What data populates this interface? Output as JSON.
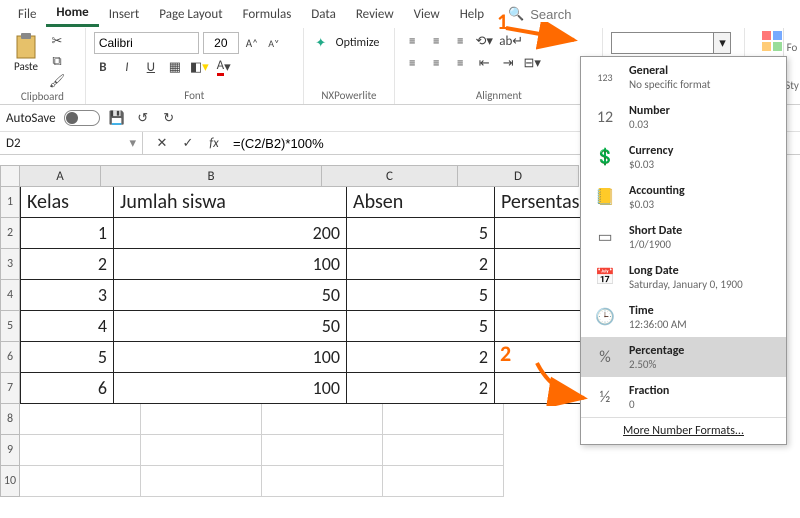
{
  "tabs": {
    "file": "File",
    "home": "Home",
    "insert": "Insert",
    "pagelayout": "Page Layout",
    "formulas": "Formulas",
    "data": "Data",
    "review": "Review",
    "view": "View",
    "help": "Help"
  },
  "search_placeholder": "Search",
  "ribbon": {
    "paste": "Paste",
    "clipboard": "Clipboard",
    "font": "Font",
    "nxp": "NXPowerlite",
    "alignment": "Alignment",
    "styles": "Sty",
    "format": "Fo",
    "font_name": "Calibri",
    "font_size": "20",
    "optimize": "Optimize"
  },
  "autosave": "AutoSave",
  "namebox": "D2",
  "formula": "=(C2/B2)*100%",
  "cols": {
    "A": "A",
    "B": "B",
    "C": "C",
    "D": "D"
  },
  "headers": {
    "A": "Kelas",
    "B": "Jumlah siswa",
    "C": "Absen",
    "D": "Persentase"
  },
  "rows": [
    {
      "n": "1"
    },
    {
      "n": "2",
      "A": "1",
      "B": "200",
      "C": "5",
      "D": ""
    },
    {
      "n": "3",
      "A": "2",
      "B": "100",
      "C": "2",
      "D": ""
    },
    {
      "n": "4",
      "A": "3",
      "B": "50",
      "C": "5",
      "D": ""
    },
    {
      "n": "5",
      "A": "4",
      "B": "50",
      "C": "5",
      "D": ""
    },
    {
      "n": "6",
      "A": "5",
      "B": "100",
      "C": "2",
      "D": ""
    },
    {
      "n": "7",
      "A": "6",
      "B": "100",
      "C": "2",
      "D": ""
    },
    {
      "n": "8"
    },
    {
      "n": "9"
    },
    {
      "n": "10"
    }
  ],
  "number_formats": [
    {
      "icon": "123",
      "name": "General",
      "sub": "No specific format"
    },
    {
      "icon": "12",
      "name": "Number",
      "sub": "0.03"
    },
    {
      "icon": "cur",
      "name": "Currency",
      "sub": "$0.03"
    },
    {
      "icon": "acc",
      "name": "Accounting",
      "sub": "$0.03"
    },
    {
      "icon": "sdate",
      "name": "Short Date",
      "sub": "1/0/1900"
    },
    {
      "icon": "ldate",
      "name": "Long Date",
      "sub": "Saturday, January 0, 1900"
    },
    {
      "icon": "time",
      "name": "Time",
      "sub": "12:36:00 AM"
    },
    {
      "icon": "pct",
      "name": "Percentage",
      "sub": "2.50%",
      "selected": true
    },
    {
      "icon": "frac",
      "name": "Fraction",
      "sub": "0"
    }
  ],
  "more_formats": "More Number Formats...",
  "annot": {
    "one": "1",
    "two": "2"
  }
}
